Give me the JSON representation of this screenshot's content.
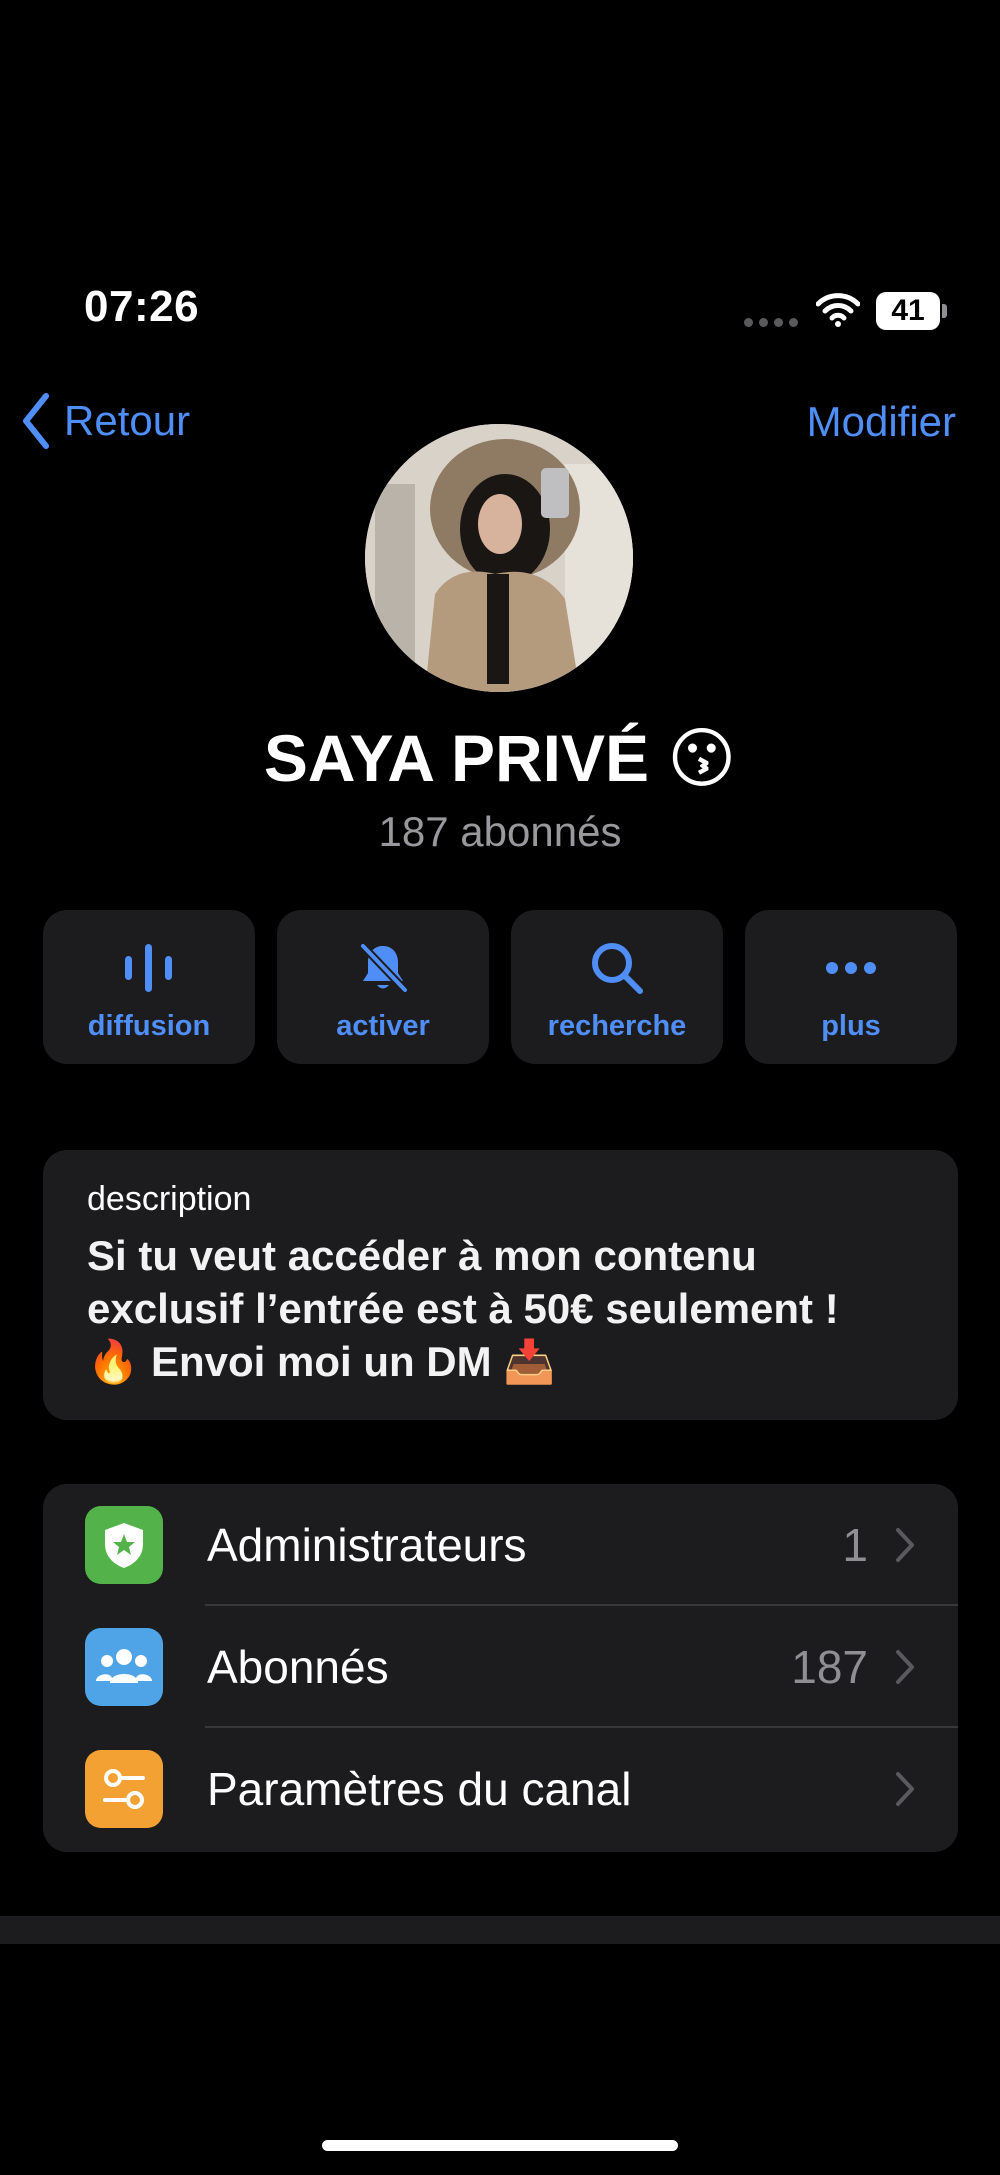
{
  "status": {
    "time": "07:26",
    "battery": "41"
  },
  "nav": {
    "back_label": "Retour",
    "edit_label": "Modifier"
  },
  "channel": {
    "name": "SAYA PRIVÉ 😗",
    "subscribers": "187 abonnés"
  },
  "actions": [
    {
      "label": "diffusion",
      "icon": "voice-chat-icon"
    },
    {
      "label": "activer",
      "icon": "bell-slash-icon"
    },
    {
      "label": "recherche",
      "icon": "search-icon"
    },
    {
      "label": "plus",
      "icon": "more-icon"
    }
  ],
  "description": {
    "label": "description",
    "lines": [
      "Si tu veut accéder à mon contenu",
      "exclusif l’entrée est à 50€ seulement !",
      "🔥 Envoi moi un DM 📥"
    ]
  },
  "list": [
    {
      "label": "Administrateurs",
      "count": "1",
      "color": "#53b34a",
      "icon": "admin-badge-icon"
    },
    {
      "label": "Abonnés",
      "count": "187",
      "color": "#4ea4e6",
      "icon": "users-icon"
    },
    {
      "label": "Paramètres du canal",
      "count": "",
      "color": "#f4a133",
      "icon": "settings-toggle-icon"
    }
  ],
  "colors": {
    "accent": "#4f8ef7",
    "card": "#1c1c1e",
    "background": "#000000"
  }
}
